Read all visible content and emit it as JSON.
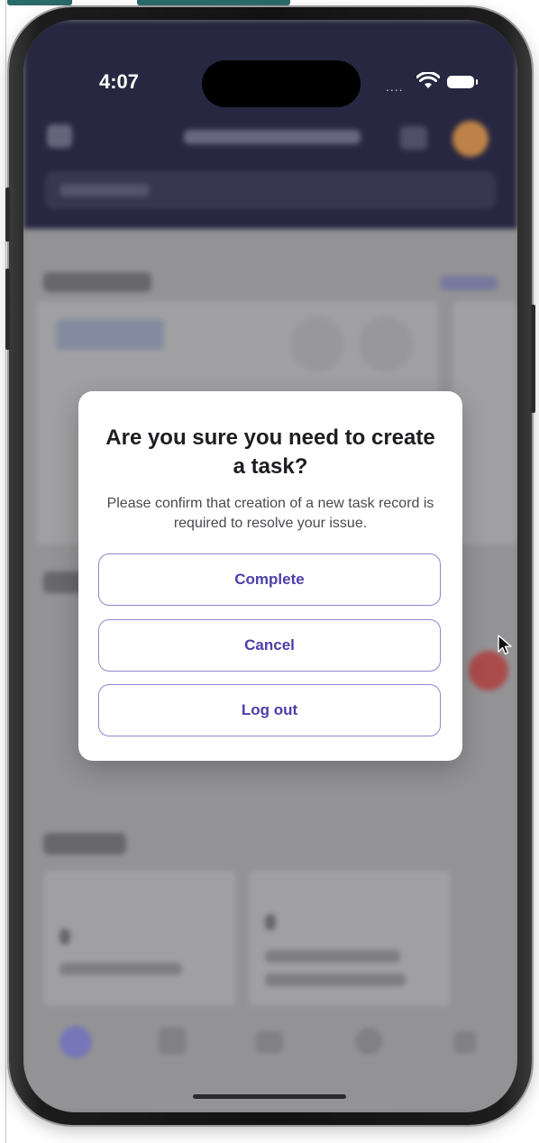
{
  "status_bar": {
    "time": "4:07",
    "signal_text": "...."
  },
  "dialog": {
    "title": "Are you sure you need to create a task?",
    "message": "Please confirm that creation of a new task record is required to resolve your issue.",
    "buttons": {
      "complete": "Complete",
      "cancel": "Cancel",
      "logout": "Log out"
    }
  },
  "colors": {
    "accent": "#4b3fa8",
    "button_border": "#8e88c8",
    "header_bg": "#2b2a45",
    "dialog_bg": "#ffffff"
  },
  "icons": {
    "status": [
      "wifi-icon",
      "battery-icon"
    ],
    "cursor": "mouse-pointer-icon"
  }
}
